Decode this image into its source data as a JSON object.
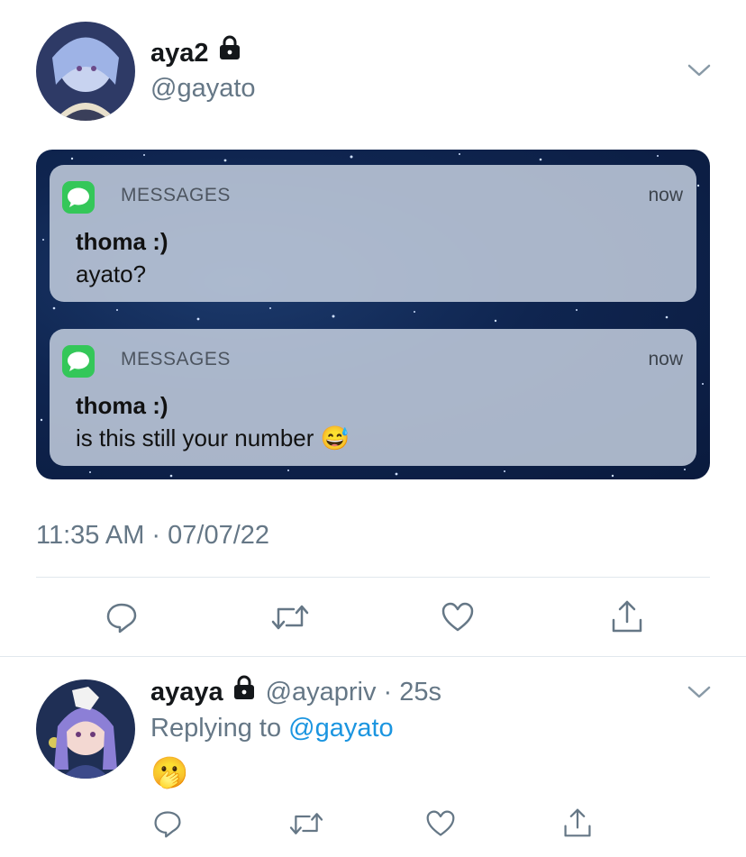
{
  "tweet": {
    "display_name": "aya2",
    "handle": "@gayato",
    "timestamp": "11:35 AM · 07/07/22"
  },
  "notifications": [
    {
      "app": "MESSAGES",
      "time": "now",
      "sender": "thoma :)",
      "message": "ayato?"
    },
    {
      "app": "MESSAGES",
      "time": "now",
      "sender": "thoma :)",
      "message": "is this still your number",
      "emoji": "😅"
    }
  ],
  "reply": {
    "display_name": "ayaya",
    "handle": "@ayapriv",
    "time": "25s",
    "replying_prefix": "Replying to",
    "replying_to": "@gayato",
    "body_emoji": "🫢"
  },
  "colors": {
    "secondary_text": "#657786",
    "link": "#1b95e0",
    "divider": "#e1e8ed",
    "messages_green": "#34c759"
  },
  "icons": [
    "lock-icon",
    "chevron-down-icon",
    "reply-icon",
    "retweet-icon",
    "like-icon",
    "share-icon",
    "messages-app-icon"
  ]
}
